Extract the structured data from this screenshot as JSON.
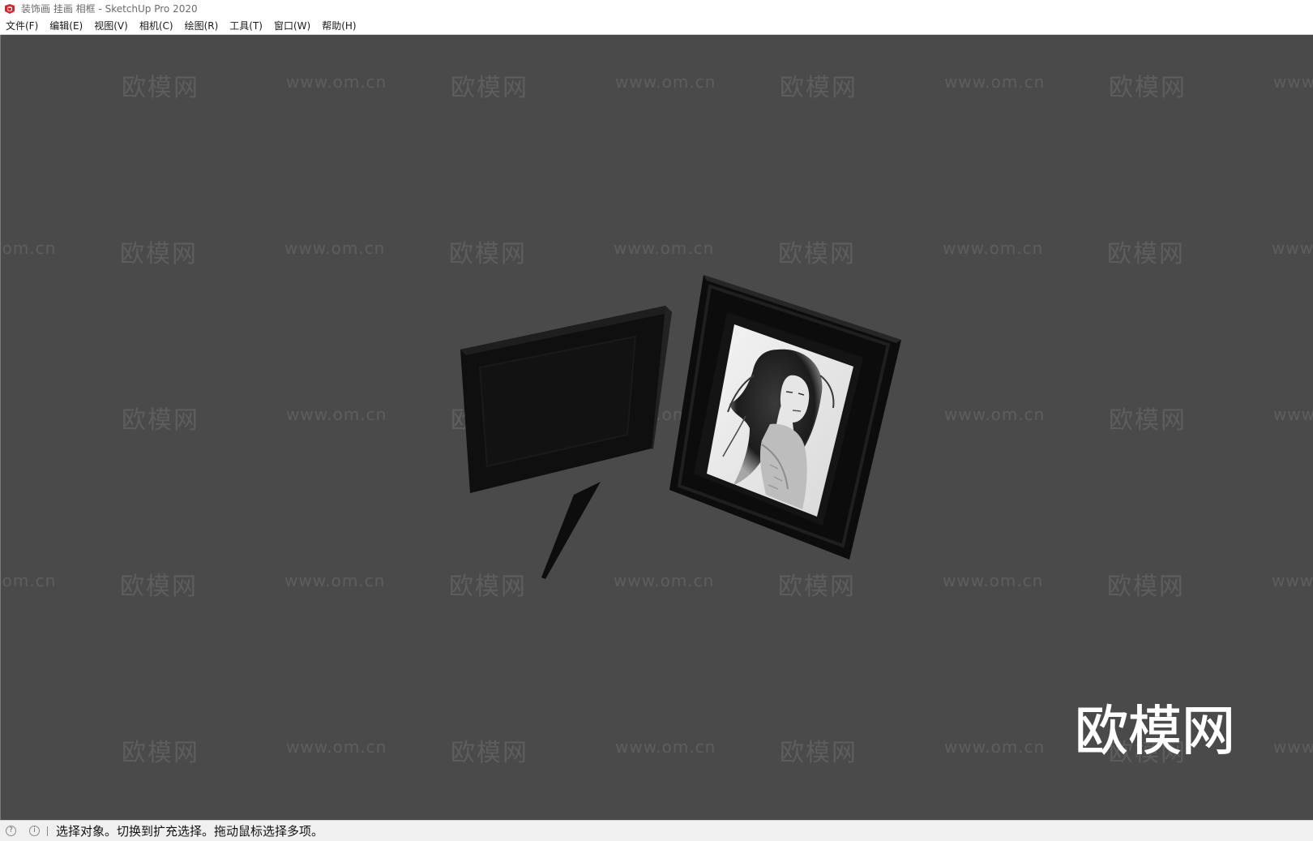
{
  "window": {
    "title": "装饰画 挂画 相框 - SketchUp Pro 2020",
    "icon": "sketchup-logo-icon"
  },
  "menu": [
    {
      "label": "文件(F)"
    },
    {
      "label": "编辑(E)"
    },
    {
      "label": "视图(V)"
    },
    {
      "label": "相机(C)"
    },
    {
      "label": "绘图(R)"
    },
    {
      "label": "工具(T)"
    },
    {
      "label": "窗口(W)"
    },
    {
      "label": "帮助(H)"
    }
  ],
  "viewport": {
    "background": "#4a4a4a",
    "models": [
      "frame-back-view",
      "frame-front-with-photo"
    ],
    "watermark_cn": "欧模网",
    "watermark_url": "www.om.cn",
    "logo_text": "欧模网"
  },
  "status": {
    "icons": [
      "geo-location-icon",
      "credits-info-icon"
    ],
    "message": "选择对象。切换到扩充选择。拖动鼠标选择多项。"
  }
}
